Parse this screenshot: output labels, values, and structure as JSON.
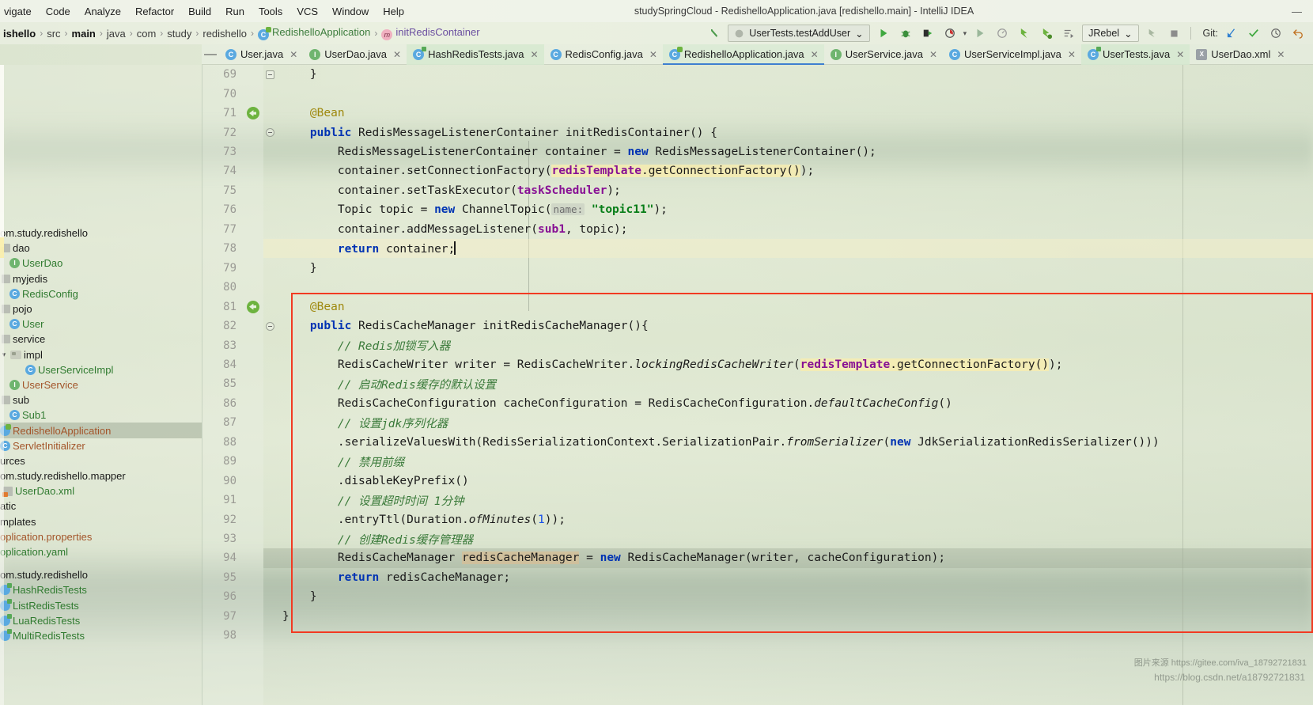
{
  "window": {
    "title": "studySpringCloud - RedishelloApplication.java [redishello.main] - IntelliJ IDEA",
    "minimize": "—",
    "maximize": "□",
    "close": "✕"
  },
  "menubar": {
    "items": [
      "vigate",
      "Code",
      "Analyze",
      "Refactor",
      "Build",
      "Run",
      "Tools",
      "VCS",
      "Window",
      "Help"
    ]
  },
  "breadcrumb": {
    "items": [
      {
        "label": "ishello",
        "type": "module"
      },
      {
        "label": "src",
        "type": "dir"
      },
      {
        "label": "main",
        "type": "dir-bold"
      },
      {
        "label": "java",
        "type": "dir"
      },
      {
        "label": "com",
        "type": "dir"
      },
      {
        "label": "study",
        "type": "dir"
      },
      {
        "label": "redishello",
        "type": "dir"
      },
      {
        "label": "RedishelloApplication",
        "type": "class"
      },
      {
        "label": "initRedisContainer",
        "type": "method"
      }
    ],
    "separator": "›"
  },
  "toolbar": {
    "run_config": "UserTests.testAddUser",
    "run_config_caret": "⌄",
    "jrebel": "JRebel",
    "jrebel_caret": "⌄",
    "git_label": "Git:",
    "icons": [
      "back-arrow-icon",
      "run-icon",
      "debug-icon",
      "run-coverage-icon",
      "profile-icon",
      "rerun-icon",
      "attach-icon",
      "jrebel-run-icon",
      "jrebel-debug-icon",
      "run-tests-icon",
      "build-icon",
      "stop-icon",
      "git-update-icon",
      "git-commit-icon",
      "git-history-icon",
      "git-rollback-icon"
    ]
  },
  "tabs": [
    {
      "label": "User.java",
      "icon": "class-icon",
      "kind": "c",
      "active": false
    },
    {
      "label": "UserDao.java",
      "icon": "interface-icon",
      "kind": "i",
      "active": false
    },
    {
      "label": "HashRedisTests.java",
      "icon": "test-class-icon",
      "kind": "test",
      "active": true
    },
    {
      "label": "RedisConfig.java",
      "icon": "class-icon",
      "kind": "c",
      "active": false
    },
    {
      "label": "RedishelloApplication.java",
      "icon": "spring-class-icon",
      "kind": "spring",
      "active": false,
      "selected": true
    },
    {
      "label": "UserService.java",
      "icon": "interface-icon",
      "kind": "i",
      "active": false
    },
    {
      "label": "UserServiceImpl.java",
      "icon": "class-icon",
      "kind": "c",
      "active": false
    },
    {
      "label": "UserTests.java",
      "icon": "test-class-icon",
      "kind": "test",
      "active": true
    },
    {
      "label": "UserDao.xml",
      "icon": "xml-file-icon",
      "kind": "xml",
      "active": false
    }
  ],
  "sidebar": {
    "items": [
      {
        "label": "om.study.redishello",
        "icon": "package-icon",
        "color": "dark",
        "indent": 0,
        "arrow": ""
      },
      {
        "label": "dao",
        "icon": "package-icon",
        "color": "dark",
        "indent": 0,
        "arrow": ""
      },
      {
        "label": "UserDao",
        "icon": "interface-icon",
        "color": "green",
        "indent": 1,
        "arrow": ""
      },
      {
        "label": "myjedis",
        "icon": "package-icon",
        "color": "dark",
        "indent": 0,
        "arrow": ""
      },
      {
        "label": "RedisConfig",
        "icon": "class-icon",
        "color": "green",
        "indent": 1,
        "arrow": ""
      },
      {
        "label": "pojo",
        "icon": "package-icon",
        "color": "dark",
        "indent": 0,
        "arrow": ""
      },
      {
        "label": "User",
        "icon": "class-icon",
        "color": "green",
        "indent": 1,
        "arrow": ""
      },
      {
        "label": "service",
        "icon": "package-icon",
        "color": "dark",
        "indent": 0,
        "arrow": ""
      },
      {
        "label": "impl",
        "icon": "folder-icon",
        "color": "dark",
        "indent": 0,
        "arrow": "▾"
      },
      {
        "label": "UserServiceImpl",
        "icon": "class-icon",
        "color": "green",
        "indent": 2,
        "arrow": ""
      },
      {
        "label": "UserService",
        "icon": "interface-icon",
        "color": "brown",
        "indent": 1,
        "arrow": ""
      },
      {
        "label": "sub",
        "icon": "package-icon",
        "color": "dark",
        "indent": 0,
        "arrow": ""
      },
      {
        "label": "Sub1",
        "icon": "class-icon",
        "color": "green",
        "indent": 1,
        "arrow": ""
      },
      {
        "label": "RedishelloApplication",
        "icon": "spring-class-icon",
        "color": "brown",
        "indent": 0,
        "arrow": "",
        "selected": true
      },
      {
        "label": "ServletInitializer",
        "icon": "class-icon",
        "color": "brown",
        "indent": 0,
        "arrow": ""
      },
      {
        "label": "urces",
        "icon": "none",
        "color": "dark",
        "indent": 0,
        "arrow": ""
      },
      {
        "label": "om.study.redishello.mapper",
        "icon": "none",
        "color": "dark",
        "indent": 0,
        "arrow": ""
      },
      {
        "label": "UserDao.xml",
        "icon": "xml-file-icon",
        "color": "green",
        "indent": 0,
        "arrow": ""
      },
      {
        "label": "atic",
        "icon": "none",
        "color": "dark",
        "indent": 0,
        "arrow": ""
      },
      {
        "label": "mplates",
        "icon": "none",
        "color": "dark",
        "indent": 0,
        "arrow": ""
      },
      {
        "label": "oplication.properties",
        "icon": "none",
        "color": "brown",
        "indent": 0,
        "arrow": ""
      },
      {
        "label": "oplication.yaml",
        "icon": "none",
        "color": "green",
        "indent": 0,
        "arrow": ""
      },
      {
        "label": "",
        "icon": "none",
        "color": "dark",
        "indent": 0,
        "arrow": "",
        "spacer": true
      },
      {
        "label": "om.study.redishello",
        "icon": "none",
        "color": "dark",
        "indent": 0,
        "arrow": ""
      },
      {
        "label": "HashRedisTests",
        "icon": "test-class-icon",
        "color": "green",
        "indent": 0,
        "arrow": ""
      },
      {
        "label": "ListRedisTests",
        "icon": "test-class-icon",
        "color": "green",
        "indent": 0,
        "arrow": ""
      },
      {
        "label": "LuaRedisTests",
        "icon": "test-class-icon",
        "color": "green",
        "indent": 0,
        "arrow": ""
      },
      {
        "label": "MultiRedisTests",
        "icon": "test-class-icon",
        "color": "green",
        "indent": 0,
        "arrow": ""
      }
    ]
  },
  "editor": {
    "first_line": 69,
    "last_line": 98,
    "line_numbers": [
      69,
      70,
      71,
      72,
      73,
      74,
      75,
      76,
      77,
      78,
      79,
      80,
      81,
      82,
      83,
      84,
      85,
      86,
      87,
      88,
      89,
      90,
      91,
      92,
      93,
      94,
      95,
      96,
      97,
      98
    ],
    "lines": [
      {
        "n": 69,
        "text": "    }",
        "fold": "minus"
      },
      {
        "n": 70,
        "text": ""
      },
      {
        "n": 71,
        "text": "    @Bean",
        "gutter": "bean"
      },
      {
        "n": 72,
        "text": "    public RedisMessageListenerContainer initRedisContainer() {",
        "fold": "circle"
      },
      {
        "n": 73,
        "text": "        RedisMessageListenerContainer container = new RedisMessageListenerContainer();"
      },
      {
        "n": 74,
        "text": "        container.setConnectionFactory(redisTemplate.getConnectionFactory());"
      },
      {
        "n": 75,
        "text": "        container.setTaskExecutor(taskScheduler);"
      },
      {
        "n": 76,
        "text": "        Topic topic = new ChannelTopic( name: \"topic11\");"
      },
      {
        "n": 77,
        "text": "        container.addMessageListener(sub1, topic);"
      },
      {
        "n": 78,
        "text": "        return container;",
        "caret": true
      },
      {
        "n": 79,
        "text": "    }"
      },
      {
        "n": 80,
        "text": ""
      },
      {
        "n": 81,
        "text": "    @Bean",
        "gutter": "bean"
      },
      {
        "n": 82,
        "text": "    public RedisCacheManager initRedisCacheManager(){",
        "fold": "circle"
      },
      {
        "n": 83,
        "text": "        // Redis加锁写入器"
      },
      {
        "n": 84,
        "text": "        RedisCacheWriter writer = RedisCacheWriter.lockingRedisCacheWriter(redisTemplate.getConnectionFactory());"
      },
      {
        "n": 85,
        "text": "        // 启动Redis缓存的默认设置"
      },
      {
        "n": 86,
        "text": "        RedisCacheConfiguration cacheConfiguration = RedisCacheConfiguration.defaultCacheConfig()"
      },
      {
        "n": 87,
        "text": "        // 设置jdk序列化器"
      },
      {
        "n": 88,
        "text": "        .serializeValuesWith(RedisSerializationContext.SerializationPair.fromSerializer(new JdkSerializationRedisSerializer()))"
      },
      {
        "n": 89,
        "text": "        // 禁用前缀"
      },
      {
        "n": 90,
        "text": "        .disableKeyPrefix()"
      },
      {
        "n": 91,
        "text": "        // 设置超时时间 1分钟"
      },
      {
        "n": 92,
        "text": "        .entryTtl(Duration.ofMinutes(1));"
      },
      {
        "n": 93,
        "text": "        // 创建Redis缓存管理器"
      },
      {
        "n": 94,
        "text": "        RedisCacheManager redisCacheManager = new RedisCacheManager(writer, cacheConfiguration);"
      },
      {
        "n": 95,
        "text": "        return redisCacheManager;"
      },
      {
        "n": 96,
        "text": "    }"
      },
      {
        "n": 97,
        "text": "}"
      },
      {
        "n": 98,
        "text": ""
      }
    ],
    "param_hint": "name:",
    "highlight_box_color": "#f23a22"
  },
  "watermark": {
    "source": "图片来源 https://gitee.com/iva_18792721831",
    "blog": "https://blog.csdn.net/a18792721831"
  }
}
